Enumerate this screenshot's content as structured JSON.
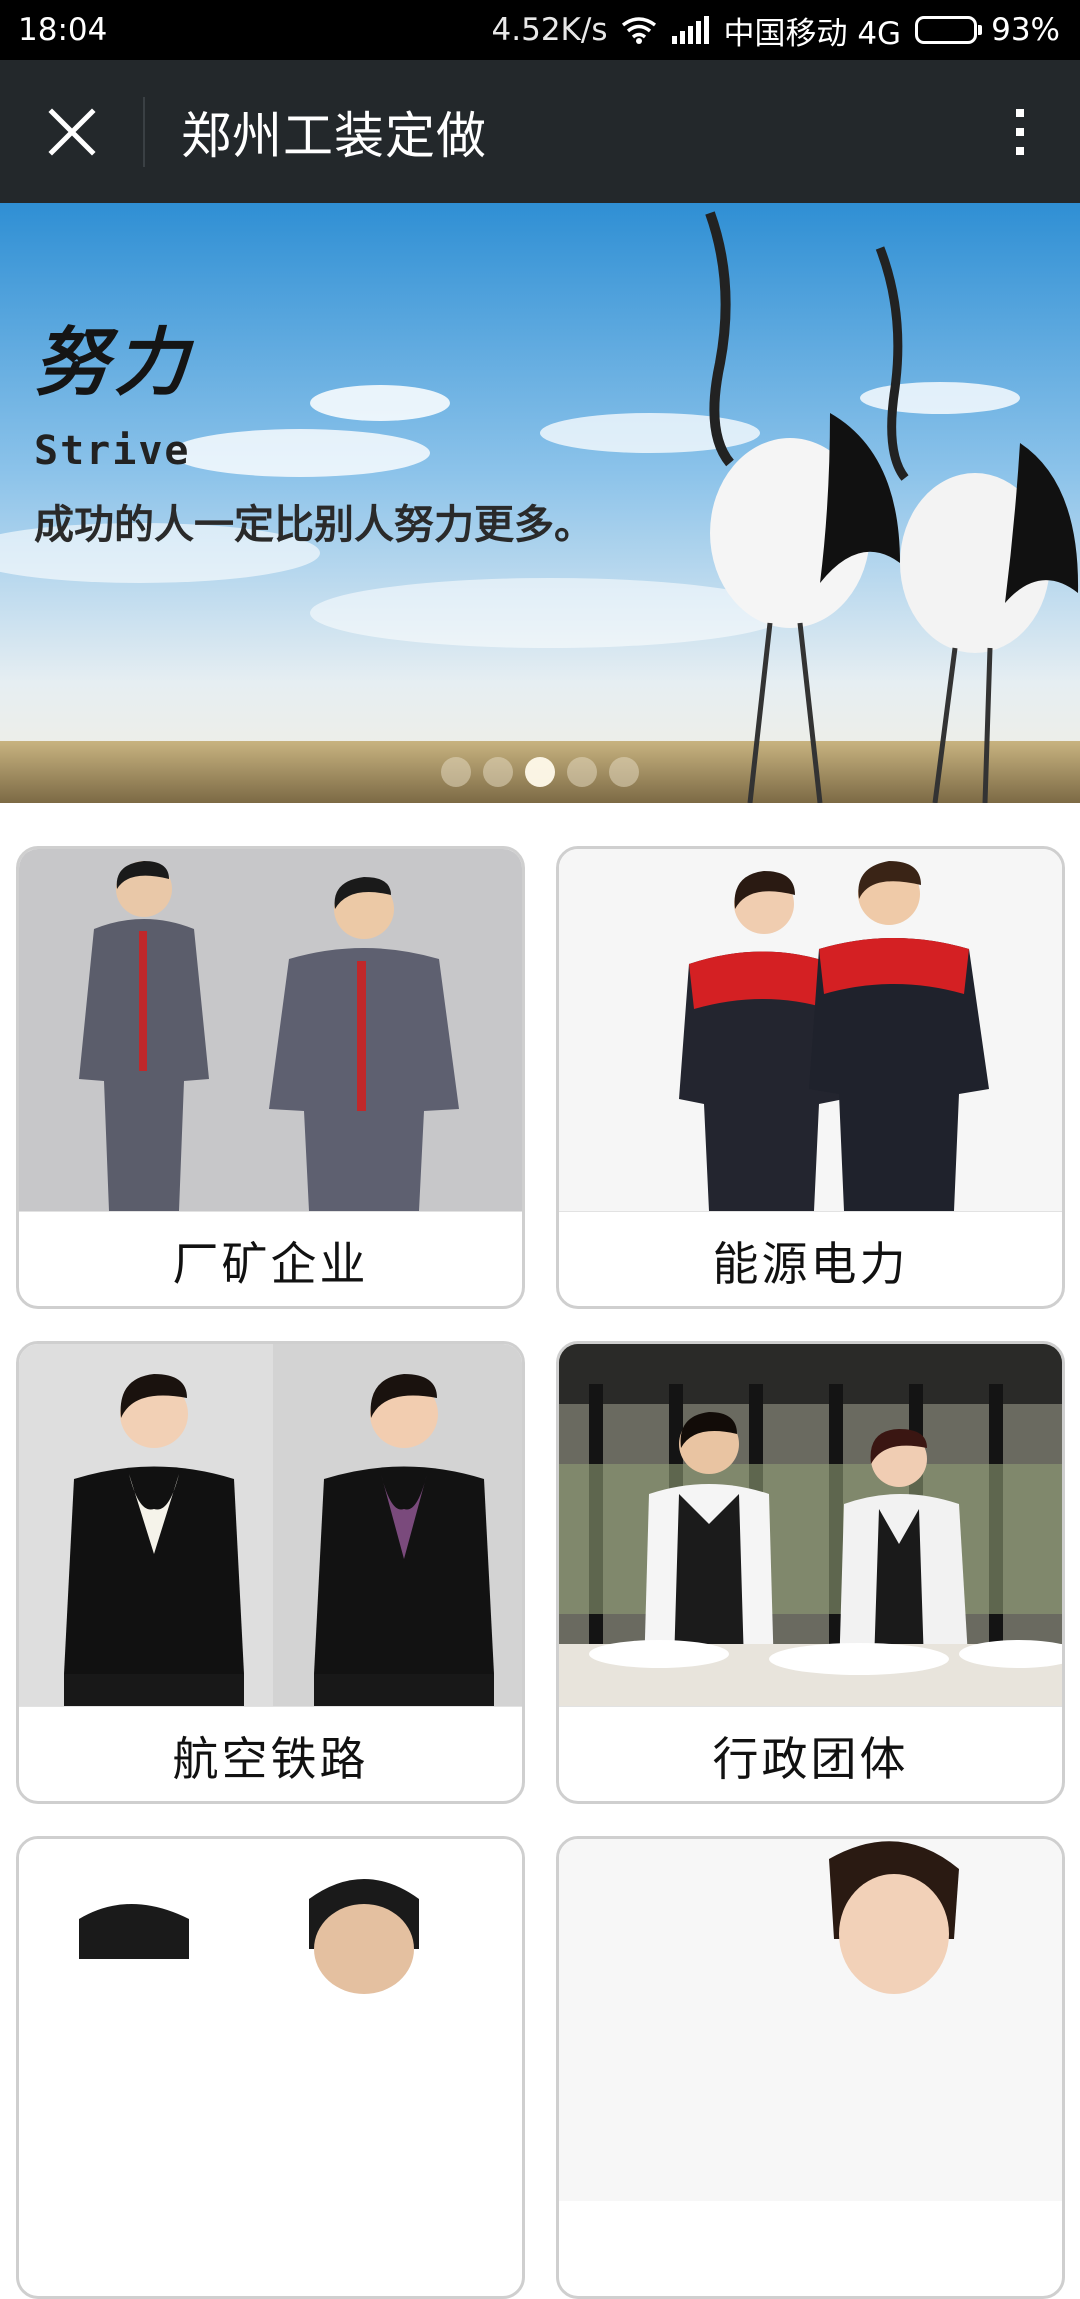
{
  "status_bar": {
    "time": "18:04",
    "network_speed": "4.52K/s",
    "carrier": "中国移动 4G",
    "battery": "93%",
    "battery_level": 0.93,
    "icons": [
      "wifi-icon",
      "signal-icon",
      "battery-icon"
    ]
  },
  "header": {
    "title": "郑州工装定做",
    "close_icon": "close-icon",
    "more_icon": "more-vertical-icon",
    "background": "#23282b"
  },
  "banner": {
    "heading": "努力",
    "subheading": "Strive",
    "slogan": "成功的人一定比别人努力更多。",
    "slide_count": 5,
    "active_slide_index": 2
  },
  "categories": [
    {
      "label": "厂矿企业"
    },
    {
      "label": "能源电力"
    },
    {
      "label": "航空铁路"
    },
    {
      "label": "行政团体"
    }
  ]
}
